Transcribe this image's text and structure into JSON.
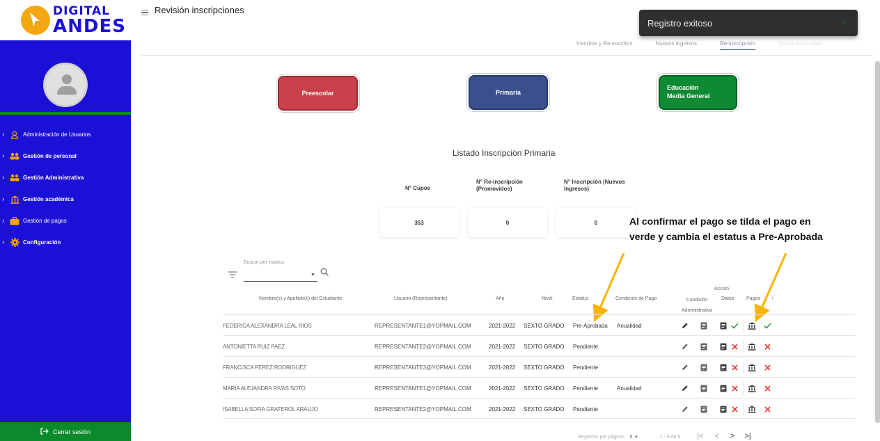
{
  "brand": {
    "line1": "DIGITAL",
    "line2": "ANDES"
  },
  "sidebar": {
    "items": [
      {
        "label": "Administración de Usuarios",
        "icon": "user-icon"
      },
      {
        "label": "Gestión de personal",
        "icon": "people-icon"
      },
      {
        "label": "Gestión Administrativa",
        "icon": "people-icon"
      },
      {
        "label": "Gestión académica",
        "icon": "institution-icon"
      },
      {
        "label": "Gestión de pagos",
        "icon": "briefcase-icon"
      },
      {
        "label": "Configuración",
        "icon": "gear-icon"
      }
    ],
    "logout_label": "Cerrar sesión"
  },
  "header": {
    "title": "Revisión inscripciones"
  },
  "tabs": [
    "Inscritos y Re-inscritos",
    "Nuevos ingresos",
    "Re-inscripción",
    "Casos especiales"
  ],
  "toast": {
    "message": "Registro exitoso",
    "close": "×"
  },
  "levels": {
    "preescolar": "Preescolar",
    "primaria": "Primaria",
    "media": "Educación Media General"
  },
  "listing": {
    "title": "Listado Inscripción Primaria",
    "stats": [
      {
        "label": "N° Cupos",
        "value": "353"
      },
      {
        "label": "N° Re-inscripción (Promovidos)",
        "value": "0"
      },
      {
        "label": "N° Inscripción (Nuevos Ingresos)",
        "value": "0"
      }
    ]
  },
  "annotation": {
    "line1": "Al confirmar el pago se tilda el pago en",
    "line2": "verde y cambia el estatus a Pre-Aprobada"
  },
  "filter": {
    "placeholder": "Buscar por estatus"
  },
  "table": {
    "headers": {
      "name": "Nombre(s) y Apellido(s) del Estudiante",
      "user": "Usuario (Representante)",
      "year": "Año",
      "level": "Nivel",
      "status": "Estatus",
      "condition": "Condición de Pago",
      "action": "Acción",
      "cond_admin": "Condición Administrativa",
      "datos": "Datos",
      "pagos": "Pagos",
      "sort": "↑"
    },
    "rows": [
      {
        "name": "FEDERICA ALEXANDRA LEAL RIOS",
        "user": "REPRESENTANTE1@YOPMAIL.COM",
        "year": "2021-2022",
        "level": "SEXTO GRADO",
        "status": "Pre-Aprobada",
        "condition": "Anualidad",
        "paid": true
      },
      {
        "name": "ANTONIETTA RUIZ PAEZ",
        "user": "REPRESENTANTE2@YOPMAIL.COM",
        "year": "2021-2022",
        "level": "SEXTO GRADO",
        "status": "Pendiente",
        "condition": "",
        "paid": false
      },
      {
        "name": "FRANCISCA PEREZ RODRIGUEZ",
        "user": "REPRESENTANTE3@YOPMAIL.COM",
        "year": "2021-2022",
        "level": "SEXTO GRADO",
        "status": "Pendiente",
        "condition": "",
        "paid": false
      },
      {
        "name": "MARIA ALEJANDRA RIVAS SOTO",
        "user": "REPRESENTANTE1@YOPMAIL.COM",
        "year": "2021-2022",
        "level": "SEXTO GRADO",
        "status": "Pendiente",
        "condition": "Anualidad",
        "paid": false
      },
      {
        "name": "ISABELLA SOFIA  GRATEROL ARAUJO",
        "user": "REPRESENTANTE2@YOPMAIL.COM",
        "year": "2021-2022",
        "level": "SEXTO GRADO",
        "status": "Pendiente",
        "condition": "",
        "paid": false
      }
    ]
  },
  "pagination": {
    "label": "Registros por página:",
    "per_page": "5",
    "range": "1 - 5 de 6"
  },
  "colors": {
    "sidebar": "#1c10d6",
    "green": "#0b8a2b",
    "red": "#e53935",
    "arrow": "#f7b500"
  }
}
